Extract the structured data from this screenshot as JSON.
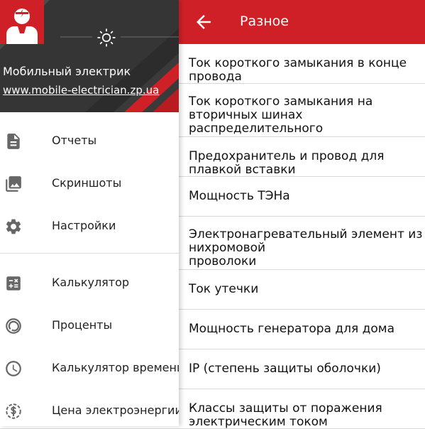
{
  "colors": {
    "accent": "#cf2027",
    "header_dark": "#3a3a3a",
    "text": "#111111",
    "icon": "#666666"
  },
  "drawer": {
    "app_name": "Мобильный электрик",
    "app_url": "www.mobile-electrician.zp.ua",
    "header_icons": [
      "electrician-avatar-icon",
      "brightness-icon"
    ],
    "items": [
      {
        "label": "Отчеты",
        "icon": "document-icon"
      },
      {
        "label": "Скриншоты",
        "icon": "image-gallery-icon"
      },
      {
        "label": "Настройки",
        "icon": "gear-icon"
      },
      {
        "label": "Калькулятор",
        "icon": "calculator-icon"
      },
      {
        "label": "Проценты",
        "icon": "percent-icon"
      },
      {
        "label": "Калькулятор времени",
        "icon": "clock-icon"
      },
      {
        "label": "Цена электроэнергии",
        "icon": "dollar-icon"
      }
    ]
  },
  "main": {
    "title": "Разное",
    "back_icon": "arrow-back-icon",
    "items": [
      "Ток короткого замыкания в конце провода",
      "Ток короткого замыкания на вторичных шинах\nраспределительного трансформатора",
      "Предохранитель и провод для плавкой вставки",
      "Мощность ТЭНа",
      "Электронагревательный элемент из нихромовой\nпроволоки",
      "Ток утечки",
      "Мощность генератора для дома",
      "IP (степень защиты оболочки)",
      "Классы защиты от поражения электрическим током"
    ]
  }
}
